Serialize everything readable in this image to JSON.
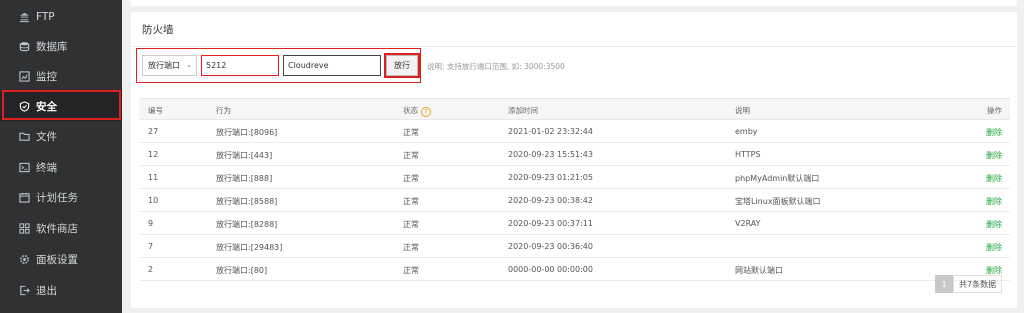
{
  "sidebar": {
    "items": [
      {
        "label": "FTP",
        "icon": "ftp-icon",
        "active": false
      },
      {
        "label": "数据库",
        "icon": "database-icon",
        "active": false
      },
      {
        "label": "监控",
        "icon": "monitor-icon",
        "active": false
      },
      {
        "label": "安全",
        "icon": "shield-icon",
        "active": true
      },
      {
        "label": "文件",
        "icon": "folder-icon",
        "active": false
      },
      {
        "label": "终端",
        "icon": "terminal-icon",
        "active": false
      },
      {
        "label": "计划任务",
        "icon": "calendar-icon",
        "active": false
      },
      {
        "label": "软件商店",
        "icon": "grid-icon",
        "active": false
      },
      {
        "label": "面板设置",
        "icon": "settings-icon",
        "active": false
      },
      {
        "label": "退出",
        "icon": "logout-icon",
        "active": false
      }
    ]
  },
  "firewall": {
    "title": "防火墙",
    "form": {
      "action_selected": "放行端口",
      "port_value": "5212",
      "note_value": "Cloudreve",
      "submit_label": "放行",
      "hint": "说明: 支持放行端口范围, 如: 3000:3500"
    },
    "table": {
      "headers": [
        "编号",
        "行为",
        "状态",
        "添加时间",
        "说明",
        "操作"
      ],
      "rows": [
        {
          "id": "27",
          "action": "放行端口:[8096]",
          "status": "正常",
          "time": "2021-01-02 23:32:44",
          "note": "emby",
          "op": "删除"
        },
        {
          "id": "12",
          "action": "放行端口:[443]",
          "status": "正常",
          "time": "2020-09-23 15:51:43",
          "note": "HTTPS",
          "op": "删除"
        },
        {
          "id": "11",
          "action": "放行端口:[888]",
          "status": "正常",
          "time": "2020-09-23 01:21:05",
          "note": "phpMyAdmin默认端口",
          "op": "删除"
        },
        {
          "id": "10",
          "action": "放行端口:[8588]",
          "status": "正常",
          "time": "2020-09-23 00:38:42",
          "note": "宝塔Linux面板默认端口",
          "op": "删除"
        },
        {
          "id": "9",
          "action": "放行端口:[8288]",
          "status": "正常",
          "time": "2020-09-23 00:37:11",
          "note": "V2RAY",
          "op": "删除"
        },
        {
          "id": "7",
          "action": "放行端口:[29483]",
          "status": "正常",
          "time": "2020-09-23 00:36:40",
          "note": "",
          "op": "删除"
        },
        {
          "id": "2",
          "action": "放行端口:[80]",
          "status": "正常",
          "time": "0000-00-00 00:00:00",
          "note": "网站默认端口",
          "op": "删除"
        }
      ]
    },
    "pager": {
      "current": "1",
      "total": "共7条数据"
    }
  },
  "colors": {
    "accent": "#20a53a",
    "highlight": "#e02020",
    "sidebar_bg": "#2f3133"
  }
}
